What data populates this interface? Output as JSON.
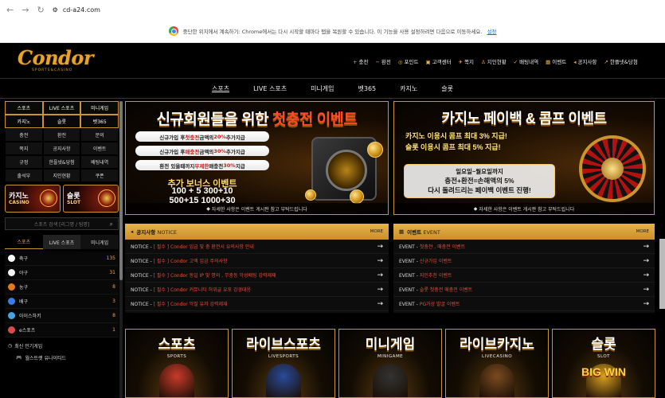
{
  "browser": {
    "url": "cd-a24.com"
  },
  "infobar": {
    "text": "중단한 위치에서 계속하기: Chrome에서는 다시 시작할 때마다 탭을 복원할 수 있습니다. 이 기능을 사용 설정하려면 다음으로 이동하세요.",
    "link": "설정"
  },
  "logo": {
    "title": "Condor",
    "subtitle": "SPORTS&CASINO"
  },
  "toplinks": [
    {
      "icon": "+",
      "label": "충전"
    },
    {
      "icon": "−",
      "label": "환전"
    },
    {
      "icon": "◎",
      "label": "포인트"
    },
    {
      "icon": "▣",
      "label": "고객센터"
    },
    {
      "icon": "✈",
      "label": "쪽지"
    },
    {
      "icon": "♙",
      "label": "지인현황"
    },
    {
      "icon": "✓",
      "label": "배팅내역"
    },
    {
      "icon": "▦",
      "label": "이벤트"
    },
    {
      "icon": "◂",
      "label": "공지사항"
    },
    {
      "icon": "↗",
      "label": "한플넷&당첨"
    }
  ],
  "mainnav": [
    "스포츠",
    "LIVE 스포츠",
    "미니게임",
    "벳365",
    "카지노",
    "슬롯"
  ],
  "sidebar": {
    "quick": [
      "스포츠",
      "LIVE 스포츠",
      "미니게임",
      "카지노",
      "슬롯",
      "벳365",
      "충전",
      "환전",
      "문의",
      "쪽지",
      "공지사항",
      "이벤트",
      "규정",
      "한플넷&당첨",
      "배팅내역",
      "출석부",
      "지인현황",
      "쿠폰"
    ],
    "banner_casino": {
      "ko": "카지노",
      "en": "CASINO"
    },
    "banner_slot": {
      "ko": "슬롯",
      "en": "SLOT"
    },
    "search_placeholder": "스포츠 검색 [리그명 / 팀명]",
    "tabs": [
      "스포츠",
      "LIVE 스포츠",
      "미니게임"
    ],
    "sports": [
      {
        "name": "축구",
        "count": "135",
        "color": "#ffffff"
      },
      {
        "name": "야구",
        "count": "31",
        "color": "#f2f2f2"
      },
      {
        "name": "농구",
        "count": "8",
        "color": "#e07a1e"
      },
      {
        "name": "배구",
        "count": "3",
        "color": "#3b7de0"
      },
      {
        "name": "아이스하키",
        "count": "8",
        "color": "#4aa3e0"
      },
      {
        "name": "e스포츠",
        "count": "1",
        "color": "#d94a4a"
      }
    ],
    "recent_title": "최신 인기게임",
    "recent_item": "월스트랫 유나이티드"
  },
  "promo1": {
    "title_a": "신규회원들을 위한 ",
    "title_b": "첫충전 이벤트",
    "conds": [
      {
        "pre": "신규가입 후 ",
        "hl": "첫충전",
        "post": " 금액의 ",
        "pct": "20%",
        "end": " 추가지급"
      },
      {
        "pre": "신규가입 후 ",
        "hl": "매충전",
        "post": " 금액의 ",
        "pct": "30%",
        "end": " 추가지급"
      },
      {
        "pre": "환전 있을때까지 ",
        "hl": "무제한",
        "post": " 매충전 ",
        "pct": "30%",
        "end": " 지급"
      }
    ],
    "bonus_title": "추가 보너스 이벤트",
    "bonus_line1": "100 + 5  300+10",
    "bonus_line2": "500+15  1000+30",
    "note": "자세한 사항은 이벤트 게시판 참고 부탁드립니다"
  },
  "promo2": {
    "title": "카지노 페이백 & 콤프 이벤트",
    "line1": "카지노 이용시 콤프 최대 3% 지급!",
    "line2": "슬롯 이용시 콤프 최대 5% 지급!",
    "box1": "일요일~월요일까지",
    "box2": "충전+환전=손해액의 5%",
    "box3": "다시 돌려드리는 페이백 이벤트 진행!",
    "note": "자세한 사항은 이벤트 게시판 참고 부탁드립니다"
  },
  "notice": {
    "title": "공지사항",
    "title_en": "NOTICE",
    "more": "MORE",
    "rows": [
      {
        "prefix": "NOTICE - ",
        "text": "[ 필수 ] Condor 입금 및 충 환전시 유의사항 안내"
      },
      {
        "prefix": "NOTICE - ",
        "text": "[ 필수 ] Condor 고액 입금 주의사항"
      },
      {
        "prefix": "NOTICE - ",
        "text": "[ 필수 ] Condor 동일 IP 및 명의 , 무충등 악성배팅 강력제재"
      },
      {
        "prefix": "NOTICE - ",
        "text": "[ 필수 ] Condor 커뮤니티 허위글 유포 강경대응"
      },
      {
        "prefix": "NOTICE - ",
        "text": "[ 필수 ] Condor 악질 유저 강력제재"
      }
    ]
  },
  "event": {
    "title": "이벤트",
    "title_en": "EVENT",
    "more": "MORE",
    "rows": [
      {
        "prefix": "EVENT - ",
        "text": "첫충전 , 매충전 이벤트"
      },
      {
        "prefix": "EVENT - ",
        "text": "신규가입 이벤트"
      },
      {
        "prefix": "EVENT - ",
        "text": "지인추천 이벤트"
      },
      {
        "prefix": "EVENT - ",
        "text": "슬롯 첫충전 매충전 이벤트"
      },
      {
        "prefix": "EVENT - ",
        "text": "PG거상 발굴 이벤트"
      }
    ]
  },
  "categories": [
    {
      "ko": "스포츠",
      "en": "SPORTS",
      "color": "#c93a2a"
    },
    {
      "ko": "라이브스포츠",
      "en": "LIVESPORTS",
      "color": "#2a4a9a"
    },
    {
      "ko": "미니게임",
      "en": "MINIGAME",
      "color": "#333333"
    },
    {
      "ko": "라이브카지노",
      "en": "LIVECASINO",
      "color": "#7a4a20"
    },
    {
      "ko": "슬롯",
      "en": "SLOT",
      "color": "#d9a020"
    }
  ],
  "slot_big": "BIG WIN"
}
